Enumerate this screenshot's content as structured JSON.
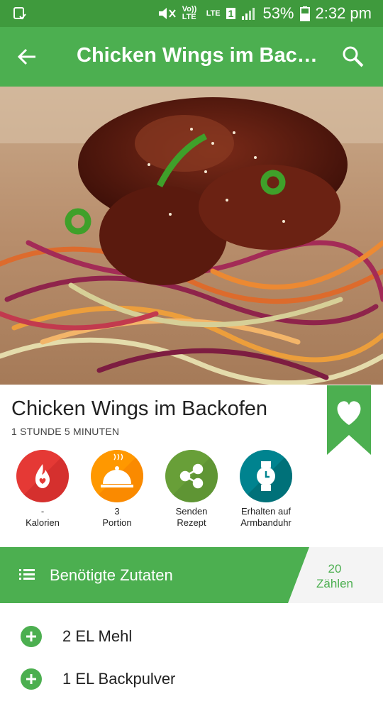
{
  "status_bar": {
    "signal_label": "Vo)) LTE",
    "lte_label": "LTE",
    "sim_number": "1",
    "battery": "53%",
    "time": "2:32 pm"
  },
  "app_bar": {
    "title": "Chicken Wings im Back…"
  },
  "recipe": {
    "title": "Chicken Wings im Backofen",
    "duration": "1 STUNDE 5 MINUTEN"
  },
  "actions": [
    {
      "value": "-",
      "label": "Kalorien",
      "color": "#e53935",
      "icon": "calories-icon"
    },
    {
      "value": "3",
      "label": "Portion",
      "color": "#ff9800",
      "icon": "serving-dish-icon"
    },
    {
      "value": "Senden",
      "label": "Rezept",
      "color": "#689f38",
      "icon": "share-icon"
    },
    {
      "value": "Erhalten auf",
      "label": "Armbanduhr",
      "color": "#00838f",
      "icon": "watch-icon"
    }
  ],
  "ingredients_bar": {
    "label": "Benötigte Zutaten",
    "count_value": "20",
    "count_label": "Zählen"
  },
  "ingredients": [
    "2 EL Mehl",
    "1 EL Backpulver"
  ],
  "colors": {
    "status_bar": "#3f9a3d",
    "app_bar": "#4caf50",
    "accent": "#4caf50"
  }
}
